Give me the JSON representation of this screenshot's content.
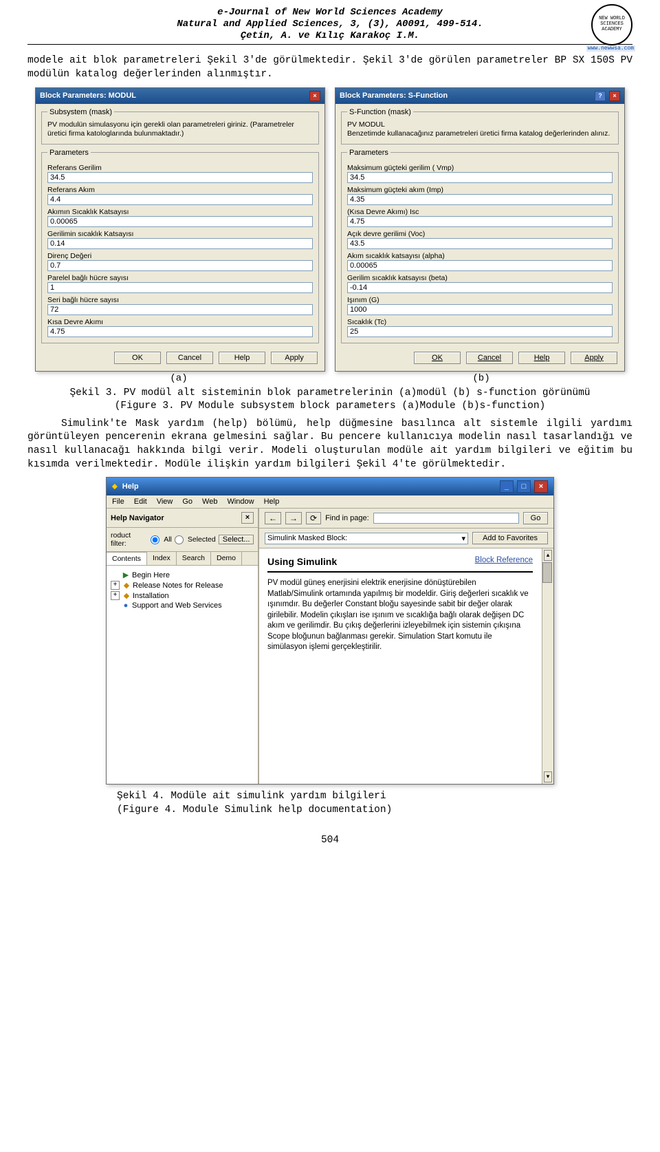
{
  "header": {
    "journal": "e-Journal of New World Sciences Academy",
    "series": "Natural and Applied Sciences, 3, (3), A0091, 499-514.",
    "authors": "Çetin, A. ve Kılıç Karakoç I.M.",
    "logo_text": "NEW WORLD SCIENCES ACADEMY",
    "logo_url": "www.newwsa.com"
  },
  "paragraphs": {
    "intro": "modele ait blok parametreleri Şekil 3'de görülmektedir. Şekil 3'de görülen parametreler BP SX 150S PV modülün katalog değerlerinden alınmıştır.",
    "fig3a": "(a)",
    "fig3b": "(b)",
    "fig3_caption_line1": "Şekil 3. PV modül alt sisteminin blok parametrelerinin (a)modül (b) s-function görünümü",
    "fig3_caption_line2": "(Figure 3. PV Module subsystem block parameters (a)Module (b)s-function)",
    "body2": "    Simulink'te Mask yardım (help) bölümü, help düğmesine basılınca alt sistemle ilgili yardımı görüntüleyen pencerenin ekrana gelmesini sağlar. Bu pencere kullanıcıya modelin nasıl tasarlandığı ve nasıl kullanacağı hakkında bilgi verir. Modeli oluşturulan modüle ait yardım bilgileri ve eğitim bu kısımda verilmektedir. Modüle ilişkin yardım bilgileri Şekil 4'te görülmektedir.",
    "fig4_caption_line1": "Şekil 4. Modüle ait simulink yardım bilgileri",
    "fig4_caption_line2": "(Figure 4. Module Simulink help documentation)"
  },
  "dialogA": {
    "title": "Block Parameters: MODUL",
    "mask_legend": "Subsystem (mask)",
    "mask_text": "PV modulün simulasyonu için gerekli olan parametreleri giriniz. (Parametreler üretici firma katologlarında bulunmaktadır.)",
    "params_legend": "Parameters",
    "params": [
      {
        "label": "Referans Gerilim",
        "value": "34.5"
      },
      {
        "label": "Referans Akım",
        "value": "4.4"
      },
      {
        "label": "Akımın Sıcaklık Katsayısı",
        "value": "0.00065"
      },
      {
        "label": "Gerilimin sıcaklık Katsayısı",
        "value": "0.14"
      },
      {
        "label": "Direnç Değeri",
        "value": "0.7"
      },
      {
        "label": "Parelel bağlı hücre sayısı",
        "value": "1"
      },
      {
        "label": "Seri bağlı hücre sayısı",
        "value": "72"
      },
      {
        "label": "Kısa Devre Akımı",
        "value": "4.75"
      }
    ],
    "buttons": {
      "ok": "OK",
      "cancel": "Cancel",
      "help": "Help",
      "apply": "Apply"
    }
  },
  "dialogB": {
    "title": "Block Parameters: S-Function",
    "mask_legend": "S-Function (mask)",
    "mask_line1": "PV MODUL",
    "mask_line2": "Benzetimde kullanacağınız parametreleri üretici firma katalog değerlerinden alınız.",
    "params_legend": "Parameters",
    "params": [
      {
        "label": "Maksimum güçteki gerilim ( Vmp)",
        "value": "34.5"
      },
      {
        "label": "Maksimum güçteki akım (Imp)",
        "value": "4.35"
      },
      {
        "label": "(Kısa Devre Akımı) Isc",
        "value": "4.75"
      },
      {
        "label": "Açık devre gerilimi (Voc)",
        "value": "43.5"
      },
      {
        "label": "Akım sıcaklık katsayısı (alpha)",
        "value": "0.00065"
      },
      {
        "label": "Gerilim sıcaklık katsayısı (beta)",
        "value": "-0.14"
      },
      {
        "label": "Işınım (G)",
        "value": "1000"
      },
      {
        "label": "Sıcaklık (Tc)",
        "value": "25"
      }
    ],
    "buttons": {
      "ok": "OK",
      "cancel": "Cancel",
      "help": "Help",
      "apply": "Apply"
    }
  },
  "helpWindow": {
    "title": "Help",
    "menu": [
      "File",
      "Edit",
      "View",
      "Go",
      "Web",
      "Window",
      "Help"
    ],
    "nav_title": "Help Navigator",
    "filter_label": "roduct filter:",
    "filter_all": "All",
    "filter_selected": "Selected",
    "filter_select_btn": "Select...",
    "tabs": [
      "Contents",
      "Index",
      "Search",
      "Demo"
    ],
    "tree": [
      {
        "expand": "",
        "icon": "▶",
        "icon_color": "#2b7a2b",
        "label": "Begin Here"
      },
      {
        "expand": "+",
        "icon": "◆",
        "icon_color": "#cc8a00",
        "label": "Release Notes for Release"
      },
      {
        "expand": "+",
        "icon": "◆",
        "icon_color": "#cc8a00",
        "label": "Installation"
      },
      {
        "expand": "",
        "icon": "●",
        "icon_color": "#2b69c7",
        "label": "Support and Web Services"
      }
    ],
    "toolbar": {
      "find_label": "Find in page:",
      "find_value": "",
      "go": "Go",
      "prev": "←",
      "next": "→",
      "reload": "⟳"
    },
    "simrow": {
      "label": "Simulink Masked Block:",
      "addfav": "Add to Favorites"
    },
    "content": {
      "title": "Using Simulink",
      "link": "Block Reference",
      "body": "PV modül güneş enerjisini elektrik enerjisine dönüştürebilen Matlab/Simulink ortamında yapılmış bir modeldir. Giriş değerleri sıcaklık ve ışınımdır. Bu değerler Constant bloğu sayesinde sabit bir değer olarak girilebilir. Modelin çıkışları ise ışınım ve sıcaklığa bağlı olarak değişen DC akım ve gerilimdir. Bu çıkış değerlerini izleyebilmek için sistemin çıkışına Scope bloğunun bağlanması gerekir. Simulation Start komutu ile simülasyon işlemi gerçekleştirilir."
    }
  },
  "page_number": "504"
}
